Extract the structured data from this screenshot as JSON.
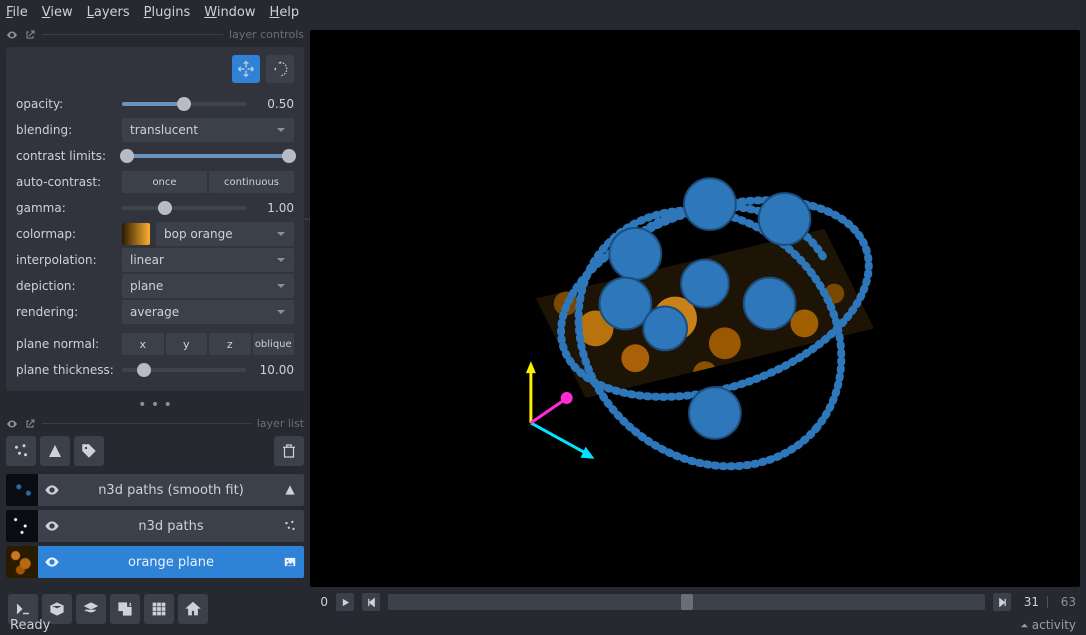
{
  "menu": {
    "items_u": [
      "F",
      "V",
      "L",
      "P",
      "W",
      "H"
    ],
    "items_rest": [
      "ile",
      "iew",
      "ayers",
      "lugins",
      "indow",
      "elp"
    ]
  },
  "panel_headers": {
    "controls": "layer controls",
    "list": "layer list"
  },
  "controls": {
    "opacity": {
      "label": "opacity:",
      "value": "0.50",
      "pct": 50
    },
    "blending": {
      "label": "blending:",
      "value": "translucent"
    },
    "contrast": {
      "label": "contrast limits:",
      "low": 2,
      "high": 98
    },
    "autocontrast": {
      "label": "auto-contrast:",
      "opt1": "once",
      "opt2": "continuous"
    },
    "gamma": {
      "label": "gamma:",
      "value": "1.00",
      "pct": 35
    },
    "colormap": {
      "label": "colormap:",
      "value": "bop orange"
    },
    "interpolation": {
      "label": "interpolation:",
      "value": "linear"
    },
    "depiction": {
      "label": "depiction:",
      "value": "plane"
    },
    "rendering": {
      "label": "rendering:",
      "value": "average"
    },
    "plane_normal": {
      "label": "plane normal:",
      "b1": "x",
      "b2": "y",
      "b3": "z",
      "b4": "oblique"
    },
    "plane_thickness": {
      "label": "plane thickness:",
      "value": "10.00",
      "pct": 18
    }
  },
  "layers": [
    {
      "name": "n3d paths (smooth fit)",
      "selected": false,
      "thumb": "paths-smooth"
    },
    {
      "name": "n3d paths",
      "selected": false,
      "thumb": "paths"
    },
    {
      "name": "orange plane",
      "selected": true,
      "thumb": "orange"
    }
  ],
  "dims": {
    "axis_label": "0",
    "cur": "31",
    "max": "63",
    "pos_pct": 49
  },
  "status": {
    "left": "Ready",
    "right": "activity"
  }
}
